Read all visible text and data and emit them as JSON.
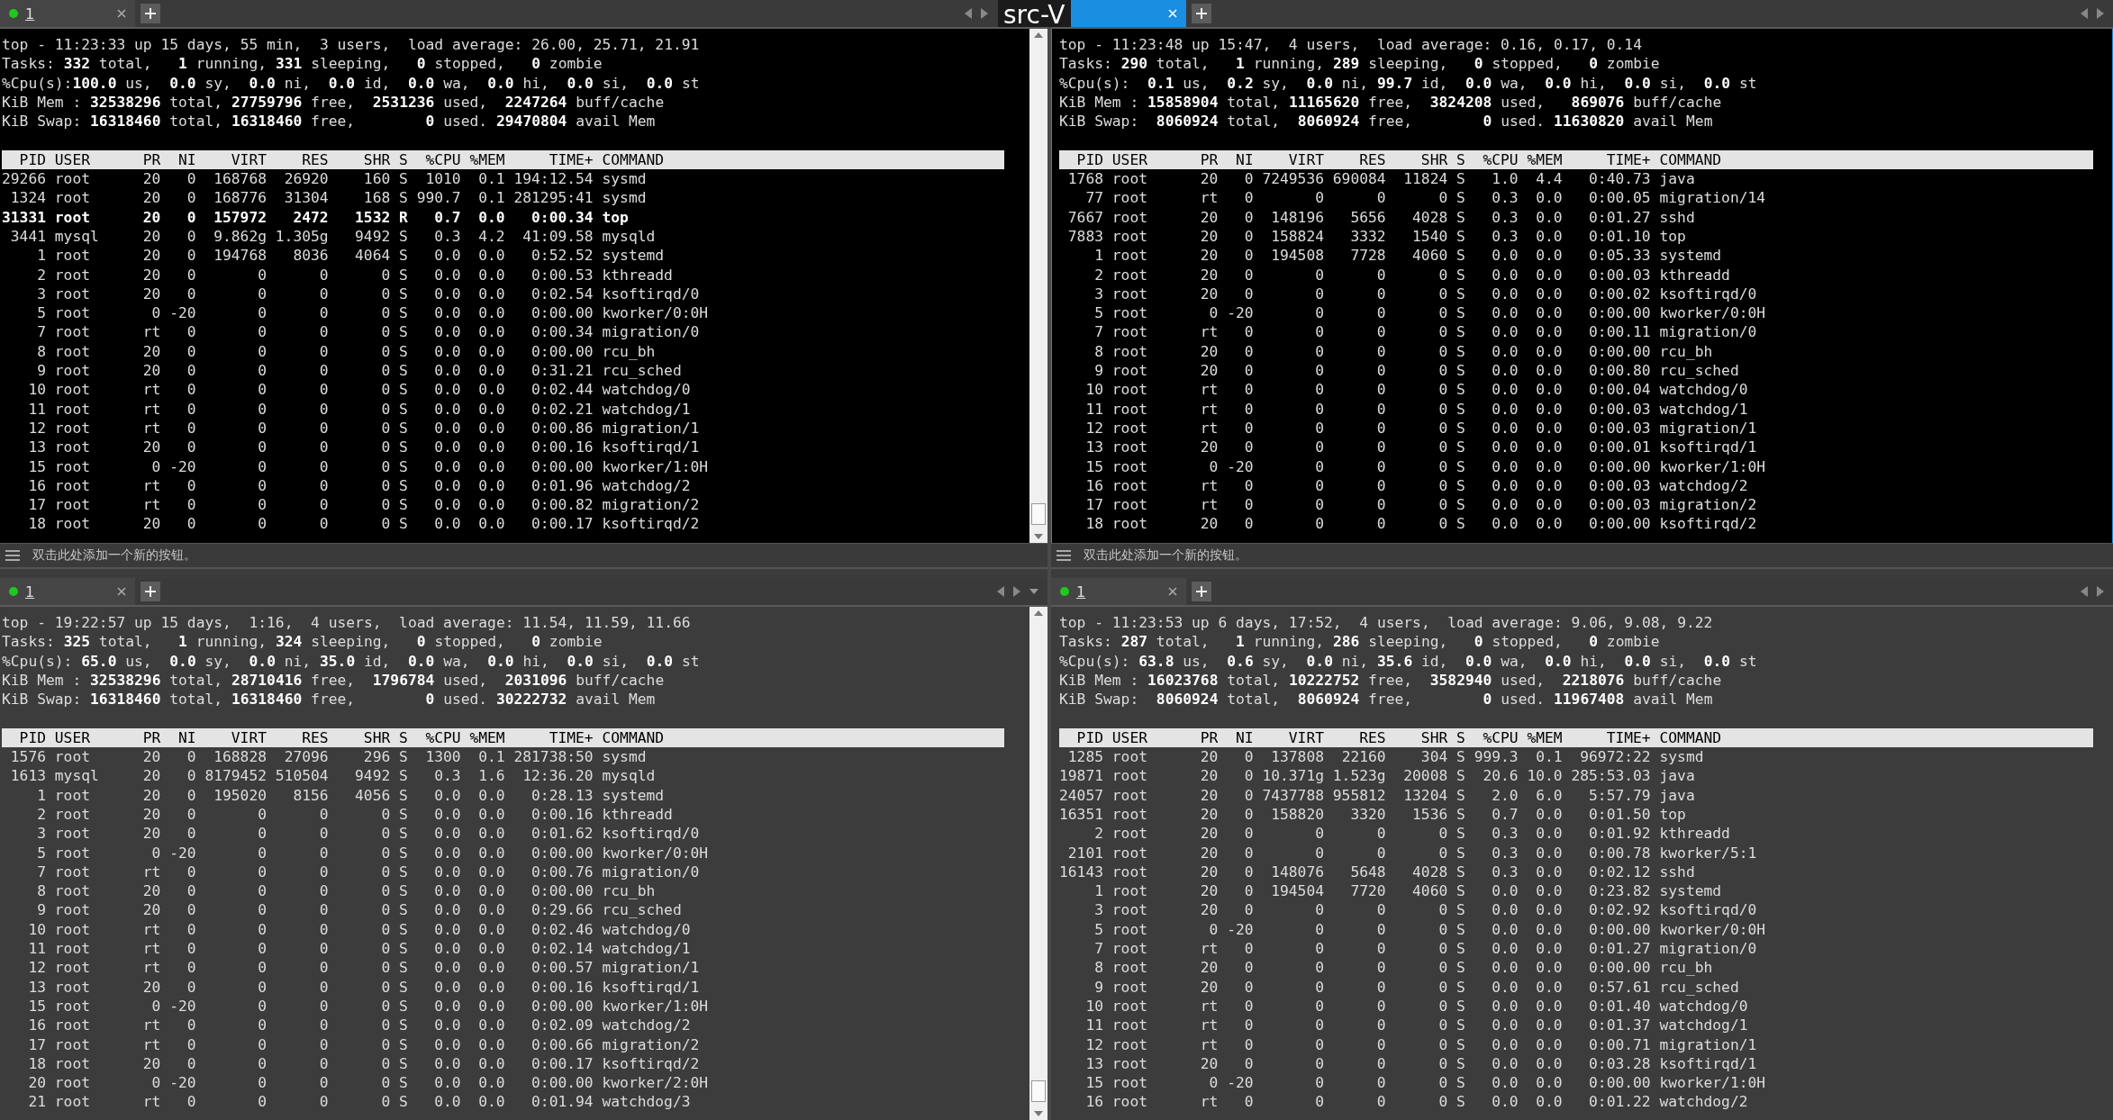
{
  "window_title_overlay": "src-V",
  "panes": [
    {
      "tab": {
        "label": "1",
        "selected": false
      },
      "scrollbar": true,
      "menu_caret": false,
      "summary": [
        "top - 11:23:33 up 15 days, 55 min,  3 users,  load average: 26.00, 25.71, 21.91",
        "Tasks: **332** total,   **1** running, **331** sleeping,   **0** stopped,   **0** zombie",
        "%Cpu(s):**100.0** us,  **0.0** sy,  **0.0** ni,  **0.0** id,  **0.0** wa,  **0.0** hi,  **0.0** si,  **0.0** st",
        "KiB Mem : **32538296** total, **27759796** free,  **2531236** used,  **2247264** buff/cache",
        "KiB Swap: **16318460** total, **16318460** free,        **0** used. **29470804** avail Mem"
      ],
      "columns": [
        "PID",
        "USER",
        "PR",
        "NI",
        "VIRT",
        "RES",
        "SHR",
        "S",
        "%CPU",
        "%MEM",
        "TIME+",
        "COMMAND"
      ],
      "rows": [
        {
          "cells": [
            "29266",
            "root",
            "20",
            "0",
            "168768",
            "26920",
            "160",
            "S",
            "1010",
            "0.1",
            "194:12.54",
            "sysmd"
          ],
          "bold": false
        },
        {
          "cells": [
            "1324",
            "root",
            "20",
            "0",
            "168776",
            "31304",
            "168",
            "S",
            "990.7",
            "0.1",
            "281295:41",
            "sysmd"
          ],
          "bold": false
        },
        {
          "cells": [
            "31331",
            "root",
            "20",
            "0",
            "157972",
            "2472",
            "1532",
            "R",
            "0.7",
            "0.0",
            "0:00.34",
            "top"
          ],
          "bold": true
        },
        {
          "cells": [
            "3441",
            "mysql",
            "20",
            "0",
            "9.862g",
            "1.305g",
            "9492",
            "S",
            "0.3",
            "4.2",
            "41:09.58",
            "mysqld"
          ],
          "bold": false
        },
        {
          "cells": [
            "1",
            "root",
            "20",
            "0",
            "194768",
            "8036",
            "4064",
            "S",
            "0.0",
            "0.0",
            "0:52.52",
            "systemd"
          ],
          "bold": false
        },
        {
          "cells": [
            "2",
            "root",
            "20",
            "0",
            "0",
            "0",
            "0",
            "S",
            "0.0",
            "0.0",
            "0:00.53",
            "kthreadd"
          ],
          "bold": false
        },
        {
          "cells": [
            "3",
            "root",
            "20",
            "0",
            "0",
            "0",
            "0",
            "S",
            "0.0",
            "0.0",
            "0:02.54",
            "ksoftirqd/0"
          ],
          "bold": false
        },
        {
          "cells": [
            "5",
            "root",
            "0",
            "-20",
            "0",
            "0",
            "0",
            "S",
            "0.0",
            "0.0",
            "0:00.00",
            "kworker/0:0H"
          ],
          "bold": false
        },
        {
          "cells": [
            "7",
            "root",
            "rt",
            "0",
            "0",
            "0",
            "0",
            "S",
            "0.0",
            "0.0",
            "0:00.34",
            "migration/0"
          ],
          "bold": false
        },
        {
          "cells": [
            "8",
            "root",
            "20",
            "0",
            "0",
            "0",
            "0",
            "S",
            "0.0",
            "0.0",
            "0:00.00",
            "rcu_bh"
          ],
          "bold": false
        },
        {
          "cells": [
            "9",
            "root",
            "20",
            "0",
            "0",
            "0",
            "0",
            "S",
            "0.0",
            "0.0",
            "0:31.21",
            "rcu_sched"
          ],
          "bold": false
        },
        {
          "cells": [
            "10",
            "root",
            "rt",
            "0",
            "0",
            "0",
            "0",
            "S",
            "0.0",
            "0.0",
            "0:02.44",
            "watchdog/0"
          ],
          "bold": false
        },
        {
          "cells": [
            "11",
            "root",
            "rt",
            "0",
            "0",
            "0",
            "0",
            "S",
            "0.0",
            "0.0",
            "0:02.21",
            "watchdog/1"
          ],
          "bold": false
        },
        {
          "cells": [
            "12",
            "root",
            "rt",
            "0",
            "0",
            "0",
            "0",
            "S",
            "0.0",
            "0.0",
            "0:00.86",
            "migration/1"
          ],
          "bold": false
        },
        {
          "cells": [
            "13",
            "root",
            "20",
            "0",
            "0",
            "0",
            "0",
            "S",
            "0.0",
            "0.0",
            "0:00.16",
            "ksoftirqd/1"
          ],
          "bold": false
        },
        {
          "cells": [
            "15",
            "root",
            "0",
            "-20",
            "0",
            "0",
            "0",
            "S",
            "0.0",
            "0.0",
            "0:00.00",
            "kworker/1:0H"
          ],
          "bold": false
        },
        {
          "cells": [
            "16",
            "root",
            "rt",
            "0",
            "0",
            "0",
            "0",
            "S",
            "0.0",
            "0.0",
            "0:01.96",
            "watchdog/2"
          ],
          "bold": false
        },
        {
          "cells": [
            "17",
            "root",
            "rt",
            "0",
            "0",
            "0",
            "0",
            "S",
            "0.0",
            "0.0",
            "0:00.82",
            "migration/2"
          ],
          "bold": false
        },
        {
          "cells": [
            "18",
            "root",
            "20",
            "0",
            "0",
            "0",
            "0",
            "S",
            "0.0",
            "0.0",
            "0:00.17",
            "ksoftirqd/2"
          ],
          "bold": false
        }
      ],
      "hint": "双击此处添加一个新的按钮。"
    },
    {
      "tab": {
        "selected": true
      },
      "scrollbar": false,
      "menu_caret": false,
      "summary": [
        "top - 11:23:48 up 15:47,  4 users,  load average: 0.16, 0.17, 0.14",
        "Tasks: **290** total,   **1** running, **289** sleeping,   **0** stopped,   **0** zombie",
        "%Cpu(s):  **0.1** us,  **0.2** sy,  **0.0** ni, **99.7** id,  **0.0** wa,  **0.0** hi,  **0.0** si,  **0.0** st",
        "KiB Mem : **15858904** total, **11165620** free,  **3824208** used,   **869076** buff/cache",
        "KiB Swap:  **8060924** total,  **8060924** free,        **0** used. **11630820** avail Mem"
      ],
      "columns": [
        "PID",
        "USER",
        "PR",
        "NI",
        "VIRT",
        "RES",
        "SHR",
        "S",
        "%CPU",
        "%MEM",
        "TIME+",
        "COMMAND"
      ],
      "rows": [
        {
          "cells": [
            "1768",
            "root",
            "20",
            "0",
            "7249536",
            "690084",
            "11824",
            "S",
            "1.0",
            "4.4",
            "0:40.73",
            "java"
          ],
          "bold": false
        },
        {
          "cells": [
            "77",
            "root",
            "rt",
            "0",
            "0",
            "0",
            "0",
            "S",
            "0.3",
            "0.0",
            "0:00.05",
            "migration/14"
          ],
          "bold": false
        },
        {
          "cells": [
            "7667",
            "root",
            "20",
            "0",
            "148196",
            "5656",
            "4028",
            "S",
            "0.3",
            "0.0",
            "0:01.27",
            "sshd"
          ],
          "bold": false
        },
        {
          "cells": [
            "7883",
            "root",
            "20",
            "0",
            "158824",
            "3332",
            "1540",
            "S",
            "0.3",
            "0.0",
            "0:01.10",
            "top"
          ],
          "bold": false
        },
        {
          "cells": [
            "1",
            "root",
            "20",
            "0",
            "194508",
            "7728",
            "4060",
            "S",
            "0.0",
            "0.0",
            "0:05.33",
            "systemd"
          ],
          "bold": false
        },
        {
          "cells": [
            "2",
            "root",
            "20",
            "0",
            "0",
            "0",
            "0",
            "S",
            "0.0",
            "0.0",
            "0:00.03",
            "kthreadd"
          ],
          "bold": false
        },
        {
          "cells": [
            "3",
            "root",
            "20",
            "0",
            "0",
            "0",
            "0",
            "S",
            "0.0",
            "0.0",
            "0:00.02",
            "ksoftirqd/0"
          ],
          "bold": false
        },
        {
          "cells": [
            "5",
            "root",
            "0",
            "-20",
            "0",
            "0",
            "0",
            "S",
            "0.0",
            "0.0",
            "0:00.00",
            "kworker/0:0H"
          ],
          "bold": false
        },
        {
          "cells": [
            "7",
            "root",
            "rt",
            "0",
            "0",
            "0",
            "0",
            "S",
            "0.0",
            "0.0",
            "0:00.11",
            "migration/0"
          ],
          "bold": false
        },
        {
          "cells": [
            "8",
            "root",
            "20",
            "0",
            "0",
            "0",
            "0",
            "S",
            "0.0",
            "0.0",
            "0:00.00",
            "rcu_bh"
          ],
          "bold": false
        },
        {
          "cells": [
            "9",
            "root",
            "20",
            "0",
            "0",
            "0",
            "0",
            "S",
            "0.0",
            "0.0",
            "0:00.80",
            "rcu_sched"
          ],
          "bold": false
        },
        {
          "cells": [
            "10",
            "root",
            "rt",
            "0",
            "0",
            "0",
            "0",
            "S",
            "0.0",
            "0.0",
            "0:00.04",
            "watchdog/0"
          ],
          "bold": false
        },
        {
          "cells": [
            "11",
            "root",
            "rt",
            "0",
            "0",
            "0",
            "0",
            "S",
            "0.0",
            "0.0",
            "0:00.03",
            "watchdog/1"
          ],
          "bold": false
        },
        {
          "cells": [
            "12",
            "root",
            "rt",
            "0",
            "0",
            "0",
            "0",
            "S",
            "0.0",
            "0.0",
            "0:00.03",
            "migration/1"
          ],
          "bold": false
        },
        {
          "cells": [
            "13",
            "root",
            "20",
            "0",
            "0",
            "0",
            "0",
            "S",
            "0.0",
            "0.0",
            "0:00.01",
            "ksoftirqd/1"
          ],
          "bold": false
        },
        {
          "cells": [
            "15",
            "root",
            "0",
            "-20",
            "0",
            "0",
            "0",
            "S",
            "0.0",
            "0.0",
            "0:00.00",
            "kworker/1:0H"
          ],
          "bold": false
        },
        {
          "cells": [
            "16",
            "root",
            "rt",
            "0",
            "0",
            "0",
            "0",
            "S",
            "0.0",
            "0.0",
            "0:00.03",
            "watchdog/2"
          ],
          "bold": false
        },
        {
          "cells": [
            "17",
            "root",
            "rt",
            "0",
            "0",
            "0",
            "0",
            "S",
            "0.0",
            "0.0",
            "0:00.03",
            "migration/2"
          ],
          "bold": false
        },
        {
          "cells": [
            "18",
            "root",
            "20",
            "0",
            "0",
            "0",
            "0",
            "S",
            "0.0",
            "0.0",
            "0:00.00",
            "ksoftirqd/2"
          ],
          "bold": false
        }
      ],
      "hint": "双击此处添加一个新的按钮。"
    },
    {
      "tab": {
        "label": "1",
        "selected": false
      },
      "scrollbar": true,
      "menu_caret": true,
      "summary": [
        "top - 19:22:57 up 15 days,  1:16,  4 users,  load average: 11.54, 11.59, 11.66",
        "Tasks: **325** total,   **1** running, **324** sleeping,   **0** stopped,   **0** zombie",
        "%Cpu(s): **65.0** us,  **0.0** sy,  **0.0** ni, **35.0** id,  **0.0** wa,  **0.0** hi,  **0.0** si,  **0.0** st",
        "KiB Mem : **32538296** total, **28710416** free,  **1796784** used,  **2031096** buff/cache",
        "KiB Swap: **16318460** total, **16318460** free,        **0** used. **30222732** avail Mem"
      ],
      "columns": [
        "PID",
        "USER",
        "PR",
        "NI",
        "VIRT",
        "RES",
        "SHR",
        "S",
        "%CPU",
        "%MEM",
        "TIME+",
        "COMMAND"
      ],
      "rows": [
        {
          "cells": [
            "1576",
            "root",
            "20",
            "0",
            "168828",
            "27096",
            "296",
            "S",
            "1300",
            "0.1",
            "281738:50",
            "sysmd"
          ],
          "bold": false
        },
        {
          "cells": [
            "1613",
            "mysql",
            "20",
            "0",
            "8179452",
            "510504",
            "9492",
            "S",
            "0.3",
            "1.6",
            "12:36.20",
            "mysqld"
          ],
          "bold": false
        },
        {
          "cells": [
            "1",
            "root",
            "20",
            "0",
            "195020",
            "8156",
            "4056",
            "S",
            "0.0",
            "0.0",
            "0:28.13",
            "systemd"
          ],
          "bold": false
        },
        {
          "cells": [
            "2",
            "root",
            "20",
            "0",
            "0",
            "0",
            "0",
            "S",
            "0.0",
            "0.0",
            "0:00.16",
            "kthreadd"
          ],
          "bold": false
        },
        {
          "cells": [
            "3",
            "root",
            "20",
            "0",
            "0",
            "0",
            "0",
            "S",
            "0.0",
            "0.0",
            "0:01.62",
            "ksoftirqd/0"
          ],
          "bold": false
        },
        {
          "cells": [
            "5",
            "root",
            "0",
            "-20",
            "0",
            "0",
            "0",
            "S",
            "0.0",
            "0.0",
            "0:00.00",
            "kworker/0:0H"
          ],
          "bold": false
        },
        {
          "cells": [
            "7",
            "root",
            "rt",
            "0",
            "0",
            "0",
            "0",
            "S",
            "0.0",
            "0.0",
            "0:00.76",
            "migration/0"
          ],
          "bold": false
        },
        {
          "cells": [
            "8",
            "root",
            "20",
            "0",
            "0",
            "0",
            "0",
            "S",
            "0.0",
            "0.0",
            "0:00.00",
            "rcu_bh"
          ],
          "bold": false
        },
        {
          "cells": [
            "9",
            "root",
            "20",
            "0",
            "0",
            "0",
            "0",
            "S",
            "0.0",
            "0.0",
            "0:29.66",
            "rcu_sched"
          ],
          "bold": false
        },
        {
          "cells": [
            "10",
            "root",
            "rt",
            "0",
            "0",
            "0",
            "0",
            "S",
            "0.0",
            "0.0",
            "0:02.46",
            "watchdog/0"
          ],
          "bold": false
        },
        {
          "cells": [
            "11",
            "root",
            "rt",
            "0",
            "0",
            "0",
            "0",
            "S",
            "0.0",
            "0.0",
            "0:02.14",
            "watchdog/1"
          ],
          "bold": false
        },
        {
          "cells": [
            "12",
            "root",
            "rt",
            "0",
            "0",
            "0",
            "0",
            "S",
            "0.0",
            "0.0",
            "0:00.57",
            "migration/1"
          ],
          "bold": false
        },
        {
          "cells": [
            "13",
            "root",
            "20",
            "0",
            "0",
            "0",
            "0",
            "S",
            "0.0",
            "0.0",
            "0:00.16",
            "ksoftirqd/1"
          ],
          "bold": false
        },
        {
          "cells": [
            "15",
            "root",
            "0",
            "-20",
            "0",
            "0",
            "0",
            "S",
            "0.0",
            "0.0",
            "0:00.00",
            "kworker/1:0H"
          ],
          "bold": false
        },
        {
          "cells": [
            "16",
            "root",
            "rt",
            "0",
            "0",
            "0",
            "0",
            "S",
            "0.0",
            "0.0",
            "0:02.09",
            "watchdog/2"
          ],
          "bold": false
        },
        {
          "cells": [
            "17",
            "root",
            "rt",
            "0",
            "0",
            "0",
            "0",
            "S",
            "0.0",
            "0.0",
            "0:00.66",
            "migration/2"
          ],
          "bold": false
        },
        {
          "cells": [
            "18",
            "root",
            "20",
            "0",
            "0",
            "0",
            "0",
            "S",
            "0.0",
            "0.0",
            "0:00.17",
            "ksoftirqd/2"
          ],
          "bold": false
        },
        {
          "cells": [
            "20",
            "root",
            "0",
            "-20",
            "0",
            "0",
            "0",
            "S",
            "0.0",
            "0.0",
            "0:00.00",
            "kworker/2:0H"
          ],
          "bold": false
        },
        {
          "cells": [
            "21",
            "root",
            "rt",
            "0",
            "0",
            "0",
            "0",
            "S",
            "0.0",
            "0.0",
            "0:01.94",
            "watchdog/3"
          ],
          "bold": false
        }
      ]
    },
    {
      "tab": {
        "label": "1",
        "selected": false
      },
      "scrollbar": false,
      "menu_caret": false,
      "summary": [
        "top - 11:23:53 up 6 days, 17:52,  4 users,  load average: 9.06, 9.08, 9.22",
        "Tasks: **287** total,   **1** running, **286** sleeping,   **0** stopped,   **0** zombie",
        "%Cpu(s): **63.8** us,  **0.6** sy,  **0.0** ni, **35.6** id,  **0.0** wa,  **0.0** hi,  **0.0** si,  **0.0** st",
        "KiB Mem : **16023768** total, **10222752** free,  **3582940** used,  **2218076** buff/cache",
        "KiB Swap:  **8060924** total,  **8060924** free,        **0** used. **11967408** avail Mem"
      ],
      "columns": [
        "PID",
        "USER",
        "PR",
        "NI",
        "VIRT",
        "RES",
        "SHR",
        "S",
        "%CPU",
        "%MEM",
        "TIME+",
        "COMMAND"
      ],
      "rows": [
        {
          "cells": [
            "1285",
            "root",
            "20",
            "0",
            "137808",
            "22160",
            "304",
            "S",
            "999.3",
            "0.1",
            "96972:22",
            "sysmd"
          ],
          "bold": false
        },
        {
          "cells": [
            "19871",
            "root",
            "20",
            "0",
            "10.371g",
            "1.523g",
            "20008",
            "S",
            "20.6",
            "10.0",
            "285:53.03",
            "java"
          ],
          "bold": false
        },
        {
          "cells": [
            "24057",
            "root",
            "20",
            "0",
            "7437788",
            "955812",
            "13204",
            "S",
            "2.0",
            "6.0",
            "5:57.79",
            "java"
          ],
          "bold": false
        },
        {
          "cells": [
            "16351",
            "root",
            "20",
            "0",
            "158820",
            "3320",
            "1536",
            "S",
            "0.7",
            "0.0",
            "0:01.50",
            "top"
          ],
          "bold": false
        },
        {
          "cells": [
            "2",
            "root",
            "20",
            "0",
            "0",
            "0",
            "0",
            "S",
            "0.3",
            "0.0",
            "0:01.92",
            "kthreadd"
          ],
          "bold": false
        },
        {
          "cells": [
            "2101",
            "root",
            "20",
            "0",
            "0",
            "0",
            "0",
            "S",
            "0.3",
            "0.0",
            "0:00.78",
            "kworker/5:1"
          ],
          "bold": false
        },
        {
          "cells": [
            "16143",
            "root",
            "20",
            "0",
            "148076",
            "5648",
            "4028",
            "S",
            "0.3",
            "0.0",
            "0:02.12",
            "sshd"
          ],
          "bold": false
        },
        {
          "cells": [
            "1",
            "root",
            "20",
            "0",
            "194504",
            "7720",
            "4060",
            "S",
            "0.0",
            "0.0",
            "0:23.82",
            "systemd"
          ],
          "bold": false
        },
        {
          "cells": [
            "3",
            "root",
            "20",
            "0",
            "0",
            "0",
            "0",
            "S",
            "0.0",
            "0.0",
            "0:02.92",
            "ksoftirqd/0"
          ],
          "bold": false
        },
        {
          "cells": [
            "5",
            "root",
            "0",
            "-20",
            "0",
            "0",
            "0",
            "S",
            "0.0",
            "0.0",
            "0:00.00",
            "kworker/0:0H"
          ],
          "bold": false
        },
        {
          "cells": [
            "7",
            "root",
            "rt",
            "0",
            "0",
            "0",
            "0",
            "S",
            "0.0",
            "0.0",
            "0:01.27",
            "migration/0"
          ],
          "bold": false
        },
        {
          "cells": [
            "8",
            "root",
            "20",
            "0",
            "0",
            "0",
            "0",
            "S",
            "0.0",
            "0.0",
            "0:00.00",
            "rcu_bh"
          ],
          "bold": false
        },
        {
          "cells": [
            "9",
            "root",
            "20",
            "0",
            "0",
            "0",
            "0",
            "S",
            "0.0",
            "0.0",
            "0:57.61",
            "rcu_sched"
          ],
          "bold": false
        },
        {
          "cells": [
            "10",
            "root",
            "rt",
            "0",
            "0",
            "0",
            "0",
            "S",
            "0.0",
            "0.0",
            "0:01.40",
            "watchdog/0"
          ],
          "bold": false
        },
        {
          "cells": [
            "11",
            "root",
            "rt",
            "0",
            "0",
            "0",
            "0",
            "S",
            "0.0",
            "0.0",
            "0:01.37",
            "watchdog/1"
          ],
          "bold": false
        },
        {
          "cells": [
            "12",
            "root",
            "rt",
            "0",
            "0",
            "0",
            "0",
            "S",
            "0.0",
            "0.0",
            "0:00.71",
            "migration/1"
          ],
          "bold": false
        },
        {
          "cells": [
            "13",
            "root",
            "20",
            "0",
            "0",
            "0",
            "0",
            "S",
            "0.0",
            "0.0",
            "0:03.28",
            "ksoftirqd/1"
          ],
          "bold": false
        },
        {
          "cells": [
            "15",
            "root",
            "0",
            "-20",
            "0",
            "0",
            "0",
            "S",
            "0.0",
            "0.0",
            "0:00.00",
            "kworker/1:0H"
          ],
          "bold": false
        },
        {
          "cells": [
            "16",
            "root",
            "rt",
            "0",
            "0",
            "0",
            "0",
            "S",
            "0.0",
            "0.0",
            "0:01.22",
            "watchdog/2"
          ],
          "bold": false
        }
      ]
    }
  ]
}
